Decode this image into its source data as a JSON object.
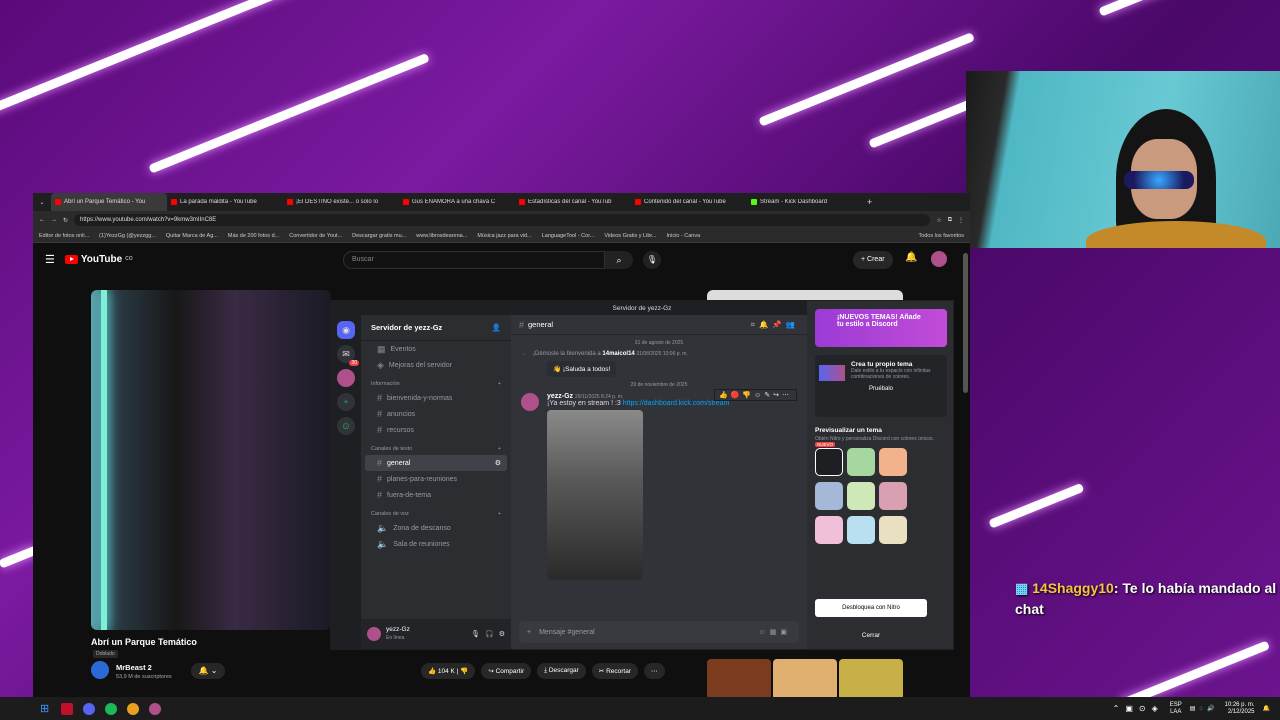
{
  "browser": {
    "tabs": [
      "Abrí un Parque Temático - You",
      "La parada maldita - YouTube",
      "¡El DESTINO existe... o solo lo",
      "Gus ENAMORA a una chava C",
      "Estadísticas del canal - YouTub",
      "Contenido del canal - YouTube",
      "Stream - Kick Dashboard"
    ],
    "url": "https://www.youtube.com/watch?v=9kmw3mIInC8E",
    "bookmarks": [
      "Editor de fotos onli...",
      "(1)YezzGg (@yezzgg...",
      "Quitar Marca de Ag...",
      "Más de 200 fotos d...",
      "Convertidor de Yout...",
      "Descargar gratis mu...",
      "www.librosdearena...",
      "Música jazz para vid...",
      "LanguageTool - Cor...",
      "Videos Gratis y Libr...",
      "Inicio - Canva",
      "Todos los favoritos"
    ]
  },
  "youtube": {
    "logo": "YouTube",
    "country": "CO",
    "search_placeholder": "Buscar",
    "create": "Crear",
    "video_title": "Abrí un Parque Temático",
    "dub_badge": "Doblado",
    "channel": "MrBeast 2",
    "subs": "53,9 M de suscriptores",
    "likes": "104 K",
    "share": "Compartir",
    "download": "Descargar",
    "clip": "Recortar"
  },
  "discord": {
    "window_title": "Servidor de yezz-Gz",
    "server_name": "Servidor de yezz-Gz",
    "badge": "30",
    "top_items": [
      "Eventos",
      "Mejoras del servidor"
    ],
    "cat_info": "Información",
    "info_channels": [
      "bienvenida-y-normas",
      "anuncios",
      "recursos"
    ],
    "cat_text": "Canales de texto",
    "text_channels": [
      "general",
      "planes-para-reuniones",
      "fuera-de-tema"
    ],
    "cat_voice": "Canales de voz",
    "voice_channels": [
      "Zona de descanso",
      "Sala de reuniones"
    ],
    "user": "yezz-Gz",
    "user_status": "En línea",
    "channel": "general",
    "search": "Buscar",
    "date1": "31 de agosto de 2025",
    "welcome": "¡Démosle la bienvenida a",
    "welcome_user": "14maicol14",
    "welcome_time": "31/08/2025 10:06 p. m.",
    "wave": "¡Saluda a todos!",
    "date2": "29 de noviembre de 2025",
    "msg_author": "yezz-Gz",
    "msg_time": "29/11/2025 8:24 p. m.",
    "msg_text": "¡Ya estoy en stream ! :3",
    "msg_link": "https://dashboard.kick.com/stream",
    "input_placeholder": "Mensaje #general",
    "promo_title": "¡NUEVOS TEMAS! Añade tu estilo a Discord",
    "own_theme": "Crea tu propio tema",
    "own_theme_desc": "Dale estilo a tu espacio con infinitas combinaciones de colores.",
    "try": "Pruébalo",
    "preview": "Previsualizar un tema",
    "preview_desc": "Obtén Nitro y personaliza Discord con colores únicos.",
    "new_label": "NUEVO",
    "unlock": "Desbloquea con Nitro",
    "close": "Cerrar"
  },
  "overlay": {
    "chat_user": "14Shaggy10",
    "chat_msg": ": Te lo había mandado al chat"
  },
  "taskbar": {
    "lang": "ESP",
    "region": "LAA",
    "time": "10:26 p. m.",
    "date": "2/12/2025"
  }
}
